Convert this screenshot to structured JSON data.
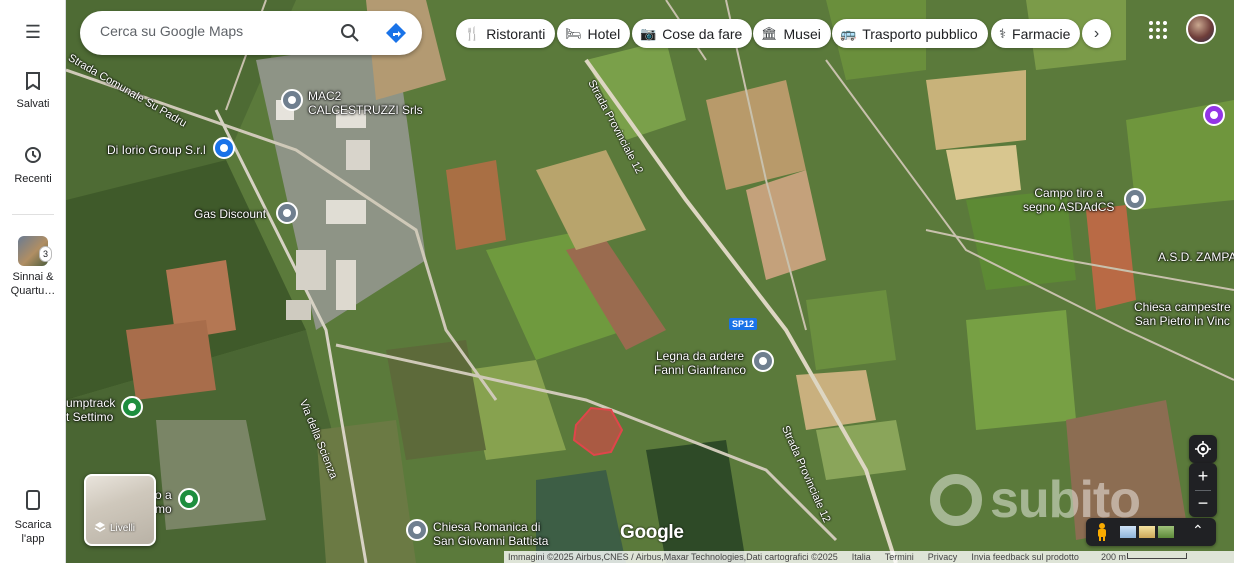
{
  "rail": {
    "saved": "Salvati",
    "recent": "Recenti",
    "recent_group": "Sinnai & Quartu…",
    "recent_count": "3",
    "download_line1": "Scarica",
    "download_line2": "l'app"
  },
  "search": {
    "placeholder": "Cerca su Google Maps"
  },
  "chips": [
    "Ristoranti",
    "Hotel",
    "Cose da fare",
    "Musei",
    "Trasporto pubblico",
    "Farmacie"
  ],
  "places": {
    "mac2_line1": "MAC2",
    "mac2_line2": "CALCESTRUZZI Srls",
    "diiorio": "Di Iorio Group S.r.l",
    "gas": "Gas Discount",
    "campo_line1": "Campo tiro a",
    "campo_line2": "segno ASDAdCS",
    "asd": "A.S.D. ZAMPA",
    "chiesa_camp_line1": "Chiesa campestre",
    "chiesa_camp_line2": "San Pietro in Vinc",
    "legna_line1": "Legna da ardere",
    "legna_line2": "Fanni Gianfranco",
    "pumptrack_line1": "umptrack",
    "pumptrack_line2": "t Settimo",
    "chiesa_rom_line1": "Chiesa Romanica di",
    "chiesa_rom_line2": "San Giovanni Battista",
    "partial_left": "o a",
    "partial_left2": "mo"
  },
  "roads": {
    "sp12_a": "Strada Provinciale 12",
    "sp12_b": "Strada Provinciale 12",
    "comunale": "Strada Comunale Su Padru",
    "scienza": "Via della Scienza",
    "shield": "SP12"
  },
  "layers": {
    "label": "Livelli"
  },
  "branding": {
    "google": "Google",
    "watermark": "subito"
  },
  "footer": {
    "attribution": "Immagini ©2025 Airbus,CNES / Airbus,Maxar Technologies,Dati cartografici ©2025",
    "italy": "Italia",
    "terms": "Termini",
    "privacy": "Privacy",
    "feedback": "Invia feedback sul prodotto",
    "scale": "200 m"
  },
  "colors": {
    "accent": "#1a73e8",
    "drawn_area": "#e0454a"
  }
}
